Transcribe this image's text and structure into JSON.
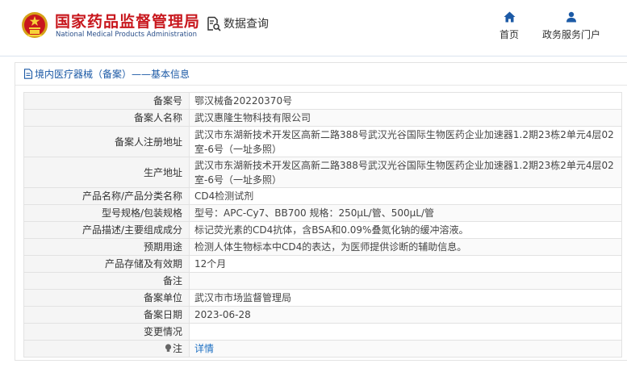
{
  "header": {
    "org_name_cn": "国家药品监督管理局",
    "org_name_en": "National Medical Products Administration",
    "query_label": "数据查询",
    "nav": {
      "home": "首页",
      "gov_portal": "政务服务门户"
    }
  },
  "panel": {
    "title": "境内医疗器械（备案）——基本信息"
  },
  "rows": [
    {
      "key": "备案号",
      "value": "鄂汉械备20220370号"
    },
    {
      "key": "备案人名称",
      "value": "武汉惠隆生物科技有限公司"
    },
    {
      "key": "备案人注册地址",
      "value": "武汉市东湖新技术开发区高新二路388号武汉光谷国际生物医药企业加速器1.2期23栋2单元4层02室-6号（一址多照）"
    },
    {
      "key": "生产地址",
      "value": "武汉市东湖新技术开发区高新二路388号武汉光谷国际生物医药企业加速器1.2期23栋2单元4层02室-6号（一址多照）"
    },
    {
      "key": "产品名称/产品分类名称",
      "value": "CD4检测试剂"
    },
    {
      "key": "型号规格/包装规格",
      "value": "型号：APC-Cy7、BB700 规格：250μL/管、500μL/管"
    },
    {
      "key": "产品描述/主要组成成分",
      "value": "标记荧光素的CD4抗体，含BSA和0.09%叠氮化钠的缓冲溶液。"
    },
    {
      "key": "预期用途",
      "value": "检测人体生物标本中CD4的表达，为医师提供诊断的辅助信息。"
    },
    {
      "key": "产品存储及有效期",
      "value": "12个月"
    },
    {
      "key": "备注",
      "value": ""
    },
    {
      "key": "备案单位",
      "value": "武汉市市场监督管理局"
    },
    {
      "key": "备案日期",
      "value": "2023-06-28"
    },
    {
      "key": "变更情况",
      "value": ""
    },
    {
      "key": "注",
      "value": "详情"
    }
  ],
  "colors": {
    "brand_red": "#c8171d",
    "link_blue": "#1c6fc2",
    "title_blue": "#1c5aa6"
  }
}
